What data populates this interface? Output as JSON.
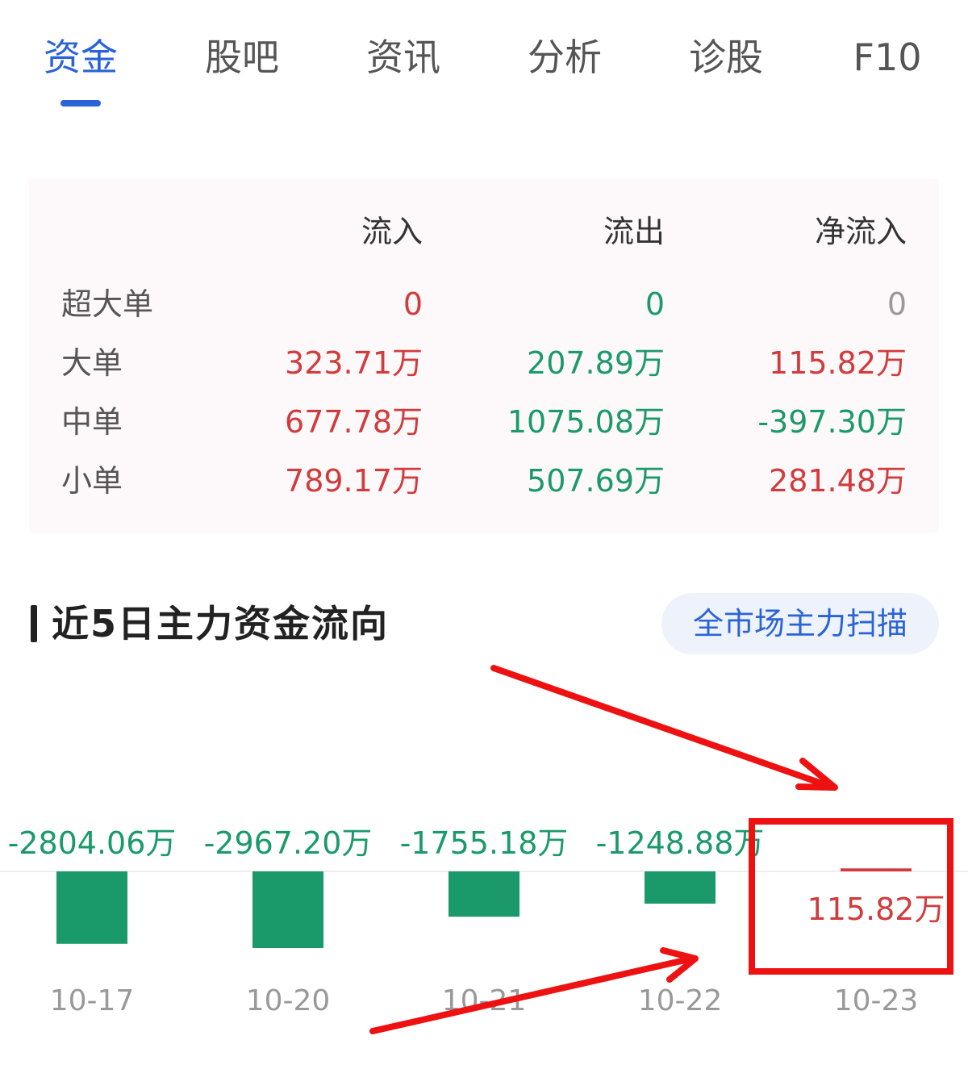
{
  "tabs": [
    {
      "label": "资金",
      "active": true
    },
    {
      "label": "股吧",
      "active": false
    },
    {
      "label": "资讯",
      "active": false
    },
    {
      "label": "分析",
      "active": false
    },
    {
      "label": "诊股",
      "active": false
    },
    {
      "label": "F10",
      "active": false
    }
  ],
  "flow_table": {
    "headers": [
      "流入",
      "流出",
      "净流入"
    ],
    "rows": [
      {
        "label": "超大单",
        "inflow": "0",
        "outflow": "0",
        "net": "0"
      },
      {
        "label": "大单",
        "inflow": "323.71万",
        "outflow": "207.89万",
        "net": "115.82万"
      },
      {
        "label": "中单",
        "inflow": "677.78万",
        "outflow": "1075.08万",
        "net": "-397.30万"
      },
      {
        "label": "小单",
        "inflow": "789.17万",
        "outflow": "507.69万",
        "net": "281.48万"
      }
    ]
  },
  "section": {
    "title": "近5日主力资金流向",
    "scan_button": "全市场主力扫描"
  },
  "colors": {
    "accent": "#2a63d8",
    "inflow_red": "#d23b3b",
    "outflow_green": "#1a9a6a",
    "neutral_gray": "#999999",
    "annotation_red": "#ee1111"
  },
  "chart_data": {
    "type": "bar",
    "categories": [
      "10-17",
      "10-20",
      "10-21",
      "10-22",
      "10-23"
    ],
    "values": [
      -2804.06,
      -2967.2,
      -1755.18,
      -1248.88,
      115.82
    ],
    "value_labels": [
      "-2804.06万",
      "-2967.20万",
      "-1755.18万",
      "-1248.88万",
      "115.82万"
    ],
    "unit": "万",
    "title": "近5日主力资金流向",
    "colors": {
      "positive": "#d23b3b",
      "negative": "#1a9a6a"
    }
  }
}
